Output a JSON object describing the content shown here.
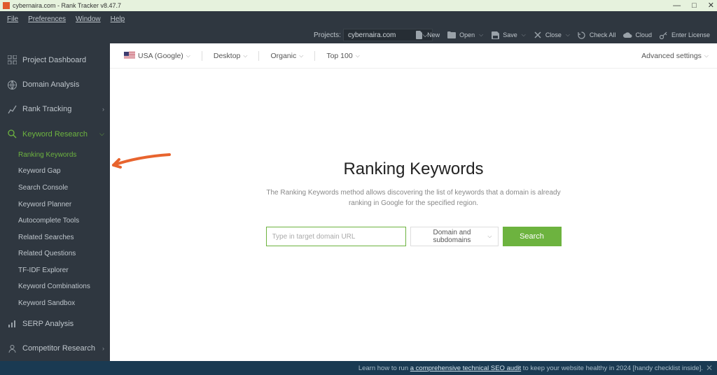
{
  "window": {
    "title": "cybernaira.com - Rank Tracker v8.47.7"
  },
  "menubar": [
    "File",
    "Preferences",
    "Window",
    "Help"
  ],
  "projects": {
    "label": "Projects:",
    "selected": "cybernaira.com"
  },
  "toolbar_actions": {
    "new": "New",
    "open": "Open",
    "save": "Save",
    "close": "Close",
    "check": "Check All",
    "cloud": "Cloud",
    "license": "Enter License"
  },
  "sidebar": {
    "items": [
      {
        "label": "Project Dashboard",
        "expandable": false
      },
      {
        "label": "Domain Analysis",
        "expandable": false
      },
      {
        "label": "Rank Tracking",
        "expandable": true
      },
      {
        "label": "Keyword Research",
        "expandable": true,
        "active": true
      },
      {
        "label": "SERP Analysis",
        "expandable": false
      },
      {
        "label": "Competitor Research",
        "expandable": true
      }
    ],
    "subitems": [
      {
        "label": "Ranking Keywords",
        "active": true
      },
      {
        "label": "Keyword Gap"
      },
      {
        "label": "Search Console"
      },
      {
        "label": "Keyword Planner"
      },
      {
        "label": "Autocomplete Tools"
      },
      {
        "label": "Related Searches"
      },
      {
        "label": "Related Questions"
      },
      {
        "label": "TF-IDF Explorer"
      },
      {
        "label": "Keyword Combinations"
      },
      {
        "label": "Keyword Sandbox"
      }
    ]
  },
  "filterbar": {
    "region": "USA (Google)",
    "device": "Desktop",
    "mode": "Organic",
    "top": "Top 100",
    "advanced": "Advanced settings"
  },
  "hero": {
    "title": "Ranking Keywords",
    "desc": "The Ranking Keywords method allows discovering the list of keywords that a domain is already ranking in Google for the specified region.",
    "placeholder": "Type in target domain URL",
    "scope": "Domain and subdomains",
    "button": "Search"
  },
  "footer": {
    "pre": "Learn how to run ",
    "link": "a comprehensive technical SEO audit",
    "post": " to keep your website healthy in 2024 [handy checklist inside]."
  }
}
